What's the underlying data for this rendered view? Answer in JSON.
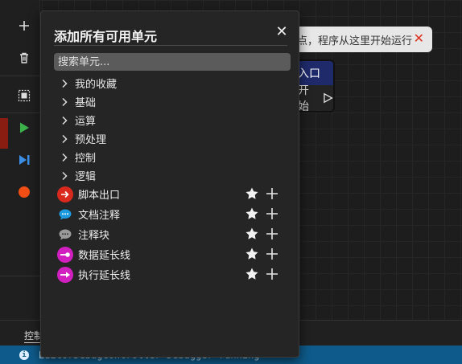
{
  "toolbar": {
    "icons": [
      "plus-icon",
      "trash-icon",
      "select-all-icon",
      "play-icon",
      "step-icon",
      "record-icon"
    ],
    "play_color": "#3bb34a",
    "step_color": "#3a8ee6",
    "record_color": "#f04e14"
  },
  "hint": {
    "text": "点，程序从这里开始运行",
    "close_glyph": "✕"
  },
  "entry_node": {
    "title": "入口",
    "body": "开始"
  },
  "popup": {
    "title": "添加所有可用单元",
    "close_glyph": "✕",
    "search_placeholder": "搜索单元...",
    "categories": [
      {
        "label": "我的收藏"
      },
      {
        "label": "基础"
      },
      {
        "label": "运算"
      },
      {
        "label": "预处理"
      },
      {
        "label": "控制"
      },
      {
        "label": "逻辑"
      }
    ],
    "units": [
      {
        "label": "脚本出口",
        "icon": "exit-arrow-icon",
        "color": "#d9291c"
      },
      {
        "label": "文档注释",
        "icon": "comment-bubble-icon",
        "color": "#1e9be0"
      },
      {
        "label": "注释块",
        "icon": "comment-block-icon",
        "color": "#9a9a9a"
      },
      {
        "label": "数据延长线",
        "icon": "data-wire-icon",
        "color": "#d21fc0"
      },
      {
        "label": "执行延长线",
        "icon": "exec-wire-icon",
        "color": "#d21fc0"
      }
    ]
  },
  "console": {
    "tab_label": "控制",
    "status_text": "EditorDebugController  Debugger running"
  }
}
